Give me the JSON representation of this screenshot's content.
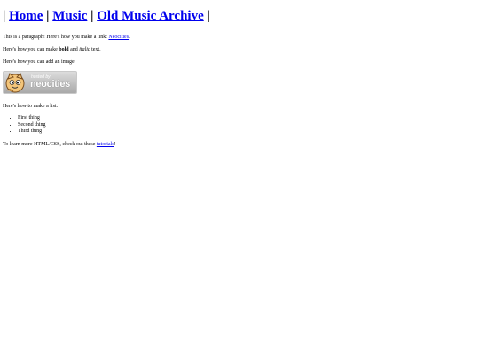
{
  "nav": {
    "separator": "|",
    "links": [
      "Home",
      "Music",
      "Old Music Archive"
    ]
  },
  "content": {
    "p1_text": "This is a paragraph! Here's how you make a link: ",
    "p1_link": "Neocities",
    "p1_end": ".",
    "p2_text": "Here's how you can make ",
    "p2_bold": "bold",
    "p2_and": " and ",
    "p2_italic": "italic",
    "p2_end": " text.",
    "p3_text": "Here's how you can add an image:",
    "banner": {
      "small_text": "hosted by",
      "big_text": "neocities",
      "icon": "neocities-cat-icon"
    },
    "p4_text": "Here's how to make a list:",
    "list_items": [
      "First thing",
      "Second thing",
      "Third thing"
    ],
    "p5_text": "To learn more HTML/CSS, check out these ",
    "p5_link": "tutorials",
    "p5_end": "!"
  },
  "colors": {
    "link": "#0000ee",
    "text": "#000000",
    "background": "#ffffff"
  }
}
